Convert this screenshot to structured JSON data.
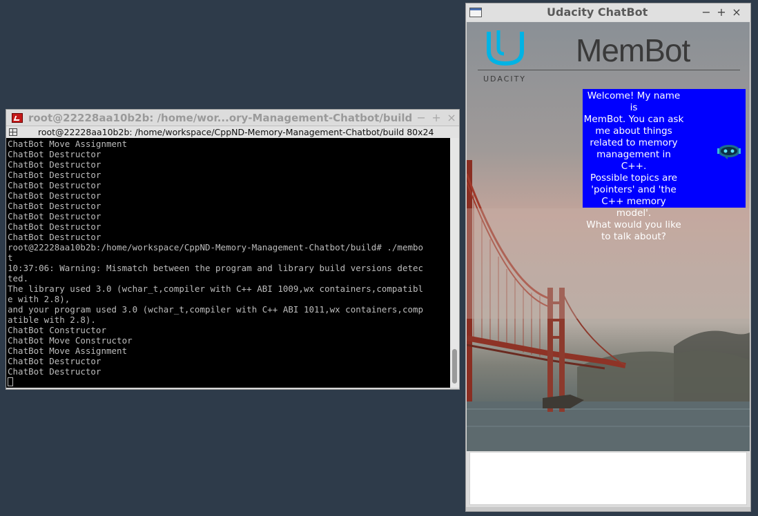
{
  "terminal": {
    "title": "root@22228aa10b2b: /home/wor...ory-Management-Chatbot/build",
    "tab_label": "root@22228aa10b2b: /home/workspace/CppND-Memory-Management-Chatbot/build 80x24",
    "buttons": {
      "minimize": "−",
      "maximize": "+",
      "close": "×"
    },
    "lines": [
      "ChatBot Move Assignment",
      "ChatBot Destructor",
      "ChatBot Destructor",
      "ChatBot Destructor",
      "ChatBot Destructor",
      "ChatBot Destructor",
      "ChatBot Destructor",
      "ChatBot Destructor",
      "ChatBot Destructor",
      "ChatBot Destructor",
      "root@22228aa10b2b:/home/workspace/CppND-Memory-Management-Chatbot/build# ./membo",
      "t",
      "10:37:06: Warning: Mismatch between the program and library build versions detec",
      "ted.",
      "The library used 3.0 (wchar_t,compiler with C++ ABI 1009,wx containers,compatibl",
      "e with 2.8),",
      "and your program used 3.0 (wchar_t,compiler with C++ ABI 1011,wx containers,comp",
      "atible with 2.8).",
      "ChatBot Constructor",
      "ChatBot Move Constructor",
      "ChatBot Move Assignment",
      "ChatBot Destructor",
      "ChatBot Destructor"
    ]
  },
  "chatbot": {
    "title": "Udacity ChatBot",
    "buttons": {
      "minimize": "−",
      "maximize": "+",
      "close": "×"
    },
    "logo_text": "UDACITY",
    "header_title": "MemBot",
    "bubble_lines": [
      "Welcome! My name is",
      "MemBot. You can ask",
      "me about things",
      "related to memory",
      "management in C++.",
      "Possible topics are",
      "'pointers' and 'the",
      "C++ memory model'.",
      "What would you like",
      "to talk about?"
    ],
    "input_value": "",
    "colors": {
      "bubble": "#0000ff",
      "logo": "#02b3e4"
    }
  }
}
